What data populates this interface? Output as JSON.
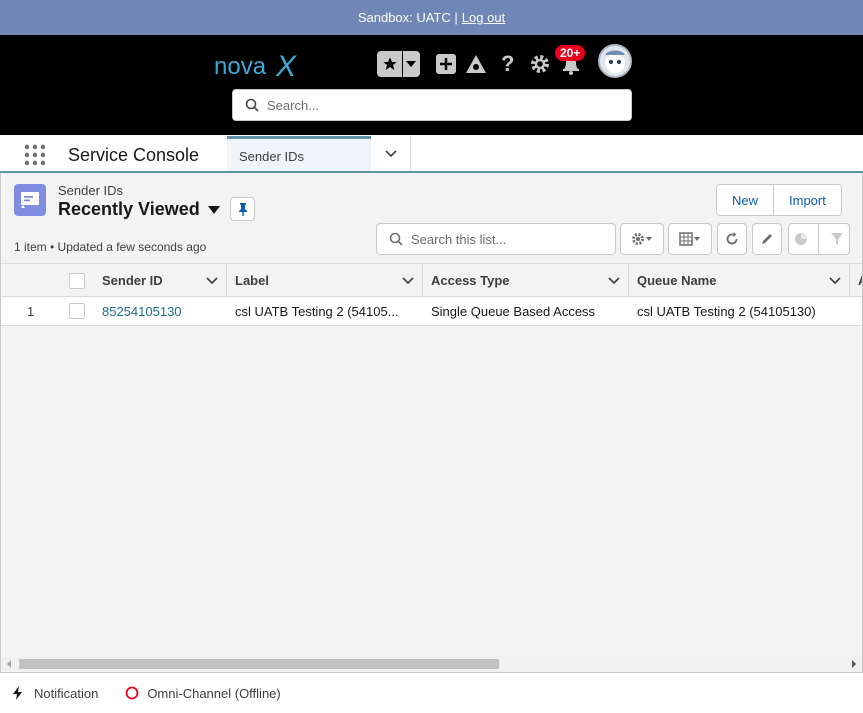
{
  "sandbox": {
    "text": "Sandbox: UATC |",
    "logout": "Log out"
  },
  "header": {
    "logo_text": "nova",
    "logo_accent": "X",
    "notification_count": "20+",
    "search_placeholder": "Search..."
  },
  "nav": {
    "app_name": "Service Console",
    "tabs": [
      {
        "label": "Sender IDs"
      }
    ]
  },
  "list": {
    "object_label": "Sender IDs",
    "view_name": "Recently Viewed",
    "buttons": {
      "new": "New",
      "import": "Import"
    },
    "search_placeholder": "Search this list...",
    "meta": "1 item • Updated a few seconds ago",
    "columns": [
      "Sender ID",
      "Label",
      "Access Type",
      "Queue Name",
      "A"
    ],
    "rows": [
      {
        "num": "1",
        "sender_id": "85254105130",
        "label": "csl UATB Testing 2 (54105...",
        "access_type": "Single Queue Based Access",
        "queue_name": "csl UATB Testing 2 (54105130)"
      }
    ]
  },
  "utility": {
    "notification": "Notification",
    "omni": "Omni-Channel (Offline)"
  },
  "colors": {
    "sandbox_bar": "#6f86b6",
    "header_bg": "#000000",
    "accent": "#5f93a6",
    "link": "#1f6e8b",
    "badge": "#ea001e",
    "object_icon": "#7f8de1"
  }
}
